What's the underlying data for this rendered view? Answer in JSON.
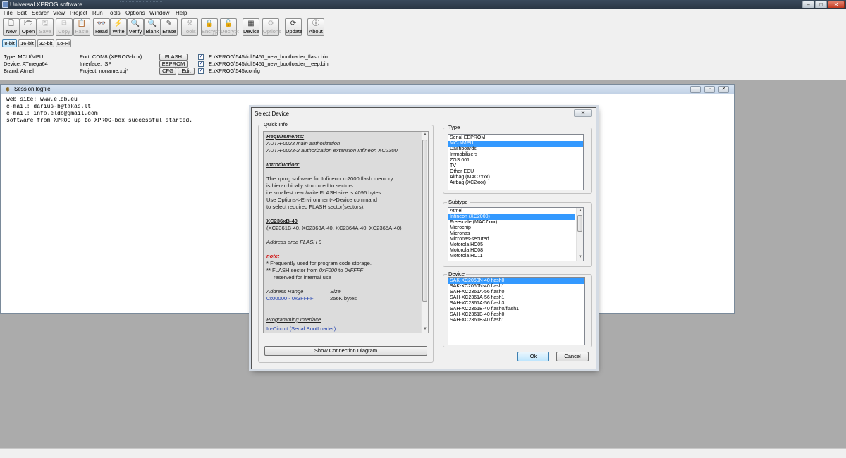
{
  "window": {
    "title": "Universal XPROG software"
  },
  "menu": [
    "File",
    "Edit",
    "Search",
    "View",
    "Project",
    "Run",
    "Tools",
    "Options",
    "Window",
    "Help"
  ],
  "toolbar": [
    {
      "label": "New",
      "icon": "new-icon",
      "glyph": "🗋",
      "enabled": true
    },
    {
      "label": "Open",
      "icon": "open-icon",
      "glyph": "🗁",
      "enabled": true
    },
    {
      "label": "Save",
      "icon": "save-icon",
      "glyph": "🖫",
      "enabled": false
    },
    {
      "label": "Copy",
      "icon": "copy-icon",
      "glyph": "⧉",
      "enabled": false
    },
    {
      "label": "Paste",
      "icon": "paste-icon",
      "glyph": "📋",
      "enabled": false
    },
    {
      "label": "Read",
      "icon": "read-icon",
      "glyph": "👓",
      "enabled": true
    },
    {
      "label": "Write",
      "icon": "write-icon",
      "glyph": "⚡",
      "enabled": true
    },
    {
      "label": "Verify",
      "icon": "verify-icon",
      "glyph": "🔍",
      "enabled": true
    },
    {
      "label": "Blank",
      "icon": "blank-icon",
      "glyph": "🔍",
      "enabled": true
    },
    {
      "label": "Erase",
      "icon": "erase-icon",
      "glyph": "✎",
      "enabled": true
    },
    {
      "label": "Tools",
      "icon": "tools-icon",
      "glyph": "⚒",
      "enabled": false
    },
    {
      "label": "Encrypt",
      "icon": "encrypt-icon",
      "glyph": "🔒",
      "enabled": false
    },
    {
      "label": "Decrypt",
      "icon": "decrypt-icon",
      "glyph": "🔓",
      "enabled": false
    },
    {
      "label": "Device",
      "icon": "device-icon",
      "glyph": "▦",
      "enabled": true
    },
    {
      "label": "Options",
      "icon": "options-icon",
      "glyph": "⚙",
      "enabled": false
    },
    {
      "label": "Update",
      "icon": "update-icon",
      "glyph": "⟳",
      "enabled": true
    },
    {
      "label": "About",
      "icon": "about-icon",
      "glyph": "ⓘ",
      "enabled": true
    }
  ],
  "bit_modes": [
    "8-bit",
    "16-bit",
    "32-bit",
    "Lo-Hi"
  ],
  "info": {
    "type": "Type: MCU/MPU",
    "device": "Device: ATmega64",
    "brand": "Brand: Atmel",
    "port": "Port: COM8 (XPROG-box)",
    "interface": "Interface: ISP",
    "project": "Project: noname.xpj*",
    "flash_btn": "FLASH",
    "eeprom_btn": "EEPROM",
    "cfg_btn": "CFG",
    "edit_btn": "Edit",
    "check_mark": "✔",
    "flash_path": "E:\\XPROG\\545\\full5451_new_bootloader_flash.bin",
    "eeprom_path": "E:\\XPROG\\545\\full5451_new_bootloader__eep.bin",
    "cfg_path": "E:\\XPROG\\545\\config"
  },
  "session": {
    "title": "Session logfile",
    "lines": [
      "web site: www.eldb.eu",
      "e-mail: darius-b@takas.lt",
      "e-mail: info.eldb@gmail.com",
      "software from XPROG up to XPROG-box successful started."
    ]
  },
  "dialog": {
    "title": "Select Device",
    "quick_info_label": "Quick Info",
    "type_label": "Type",
    "subtype_label": "Subtype",
    "device_label": "Device",
    "quick_info": {
      "req_heading": "Requirements:",
      "req_lines": [
        "AUTH-0023  main authorization",
        "AUTH-0023-2 authorization extension Infineon XC2300"
      ],
      "intro_heading": "Introduction:",
      "intro_lines": [
        "The xprog software for Infineon xc2000 flash memory",
        "is hierarchically structured to sectors",
        "i.e smallest read/write FLASH size is 4096 bytes.",
        "Use Options->Environment->Device command",
        "to select required FLASH  sector(sectors)."
      ],
      "family": "XC236xB-40",
      "family_list": "(XC2361B-40, XC2363A-40, XC2364A-40, XC2365A-40)",
      "addr_area": "Address area FLASH 0",
      "note_heading": "note:",
      "note1": "* Frequently used for program code storage.",
      "note2_prefix": "** FLASH sector from ",
      "note2_from": "0xF000",
      "note2_mid": " to ",
      "note2_to": "0xFFFF",
      "note3": "reserved for internal use",
      "addr_range_label": "Address Range",
      "size_label": "Size",
      "addr_range": "0x00000 - 0x3FFFF",
      "size": "256K bytes",
      "prog_if_heading": "Programming Interface",
      "prog_if": "In-Circuit (Serial BootLoader)"
    },
    "types": [
      "Serial EEPROM",
      "MCU/MPU",
      "Dashboards",
      "Immobilizers",
      "ZGS 001",
      "TV",
      "Other ECU",
      "Airbag (MAC7xxx)",
      "Airbag (XC2xxx)"
    ],
    "type_selected": 1,
    "subtypes": [
      "Atmel",
      "Infineon (XC2000)",
      "Freescale (MAC7xxx)",
      "Microchip",
      "Micronas",
      "Micronas-secured",
      "Motorola HC05",
      "Motorola HC08",
      "Motorola HC11"
    ],
    "subtype_selected": 1,
    "devices": [
      "SAK-XC2060N-40 flash0",
      "SAK-XC2060N-40 flash1",
      "SAH-XC2361A-56 flash0",
      "SAH-XC2361A-56 flash1",
      "SAH-XC2361A-56 flash3",
      "SAH-XC2361B-40 flash0/flash1",
      "SAH-XC2361B-40 flash0",
      "SAH-XC2361B-40 flash1"
    ],
    "device_selected": 0,
    "show_diagram": "Show Connection Diagram",
    "ok": "Ok",
    "cancel": "Cancel"
  },
  "colors": {
    "selection": "#3399ff",
    "note_red": "#d01010",
    "link_blue": "#2040b0"
  }
}
